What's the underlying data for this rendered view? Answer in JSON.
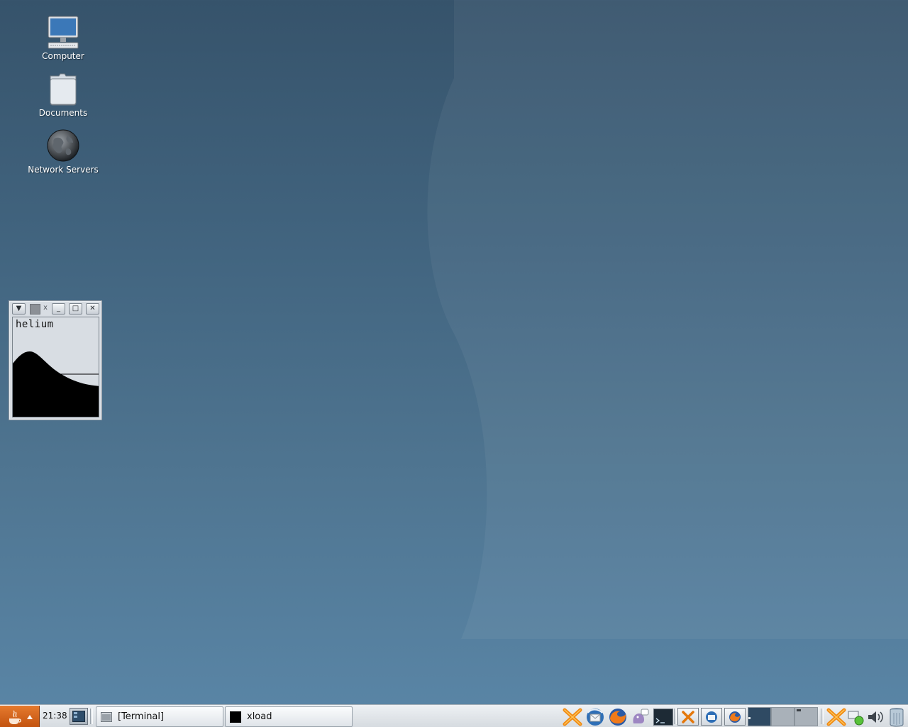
{
  "desktop": {
    "icons": [
      {
        "label": "Computer",
        "icon": "computer-icon"
      },
      {
        "label": "Documents",
        "icon": "folder-icon"
      },
      {
        "label": "Network Servers",
        "icon": "globe-icon"
      }
    ]
  },
  "xload_window": {
    "title": "x",
    "hostname": "helium",
    "buttons": {
      "menu": "▼",
      "minimize": "_",
      "maximize": "□",
      "close": "✕"
    }
  },
  "panel": {
    "clock": "21:38",
    "tasks": [
      {
        "label": "[Terminal]",
        "icon": "terminal-window-icon"
      },
      {
        "label": "xload",
        "icon": "xload-window-icon"
      }
    ],
    "launchers": [
      "crossover-icon",
      "thunderbird-icon",
      "firefox-icon",
      "pidgin-icon",
      "terminal-icon"
    ],
    "tray": [
      "crossover-icon",
      "thunderbird-icon",
      "firefox-icon"
    ],
    "status": [
      "crossover-icon",
      "network-status-icon",
      "volume-icon",
      "trash-icon"
    ]
  },
  "colors": {
    "accent_orange": "#d0621b",
    "desktop_top": "#36536b",
    "desktop_bottom": "#5a86a7"
  }
}
